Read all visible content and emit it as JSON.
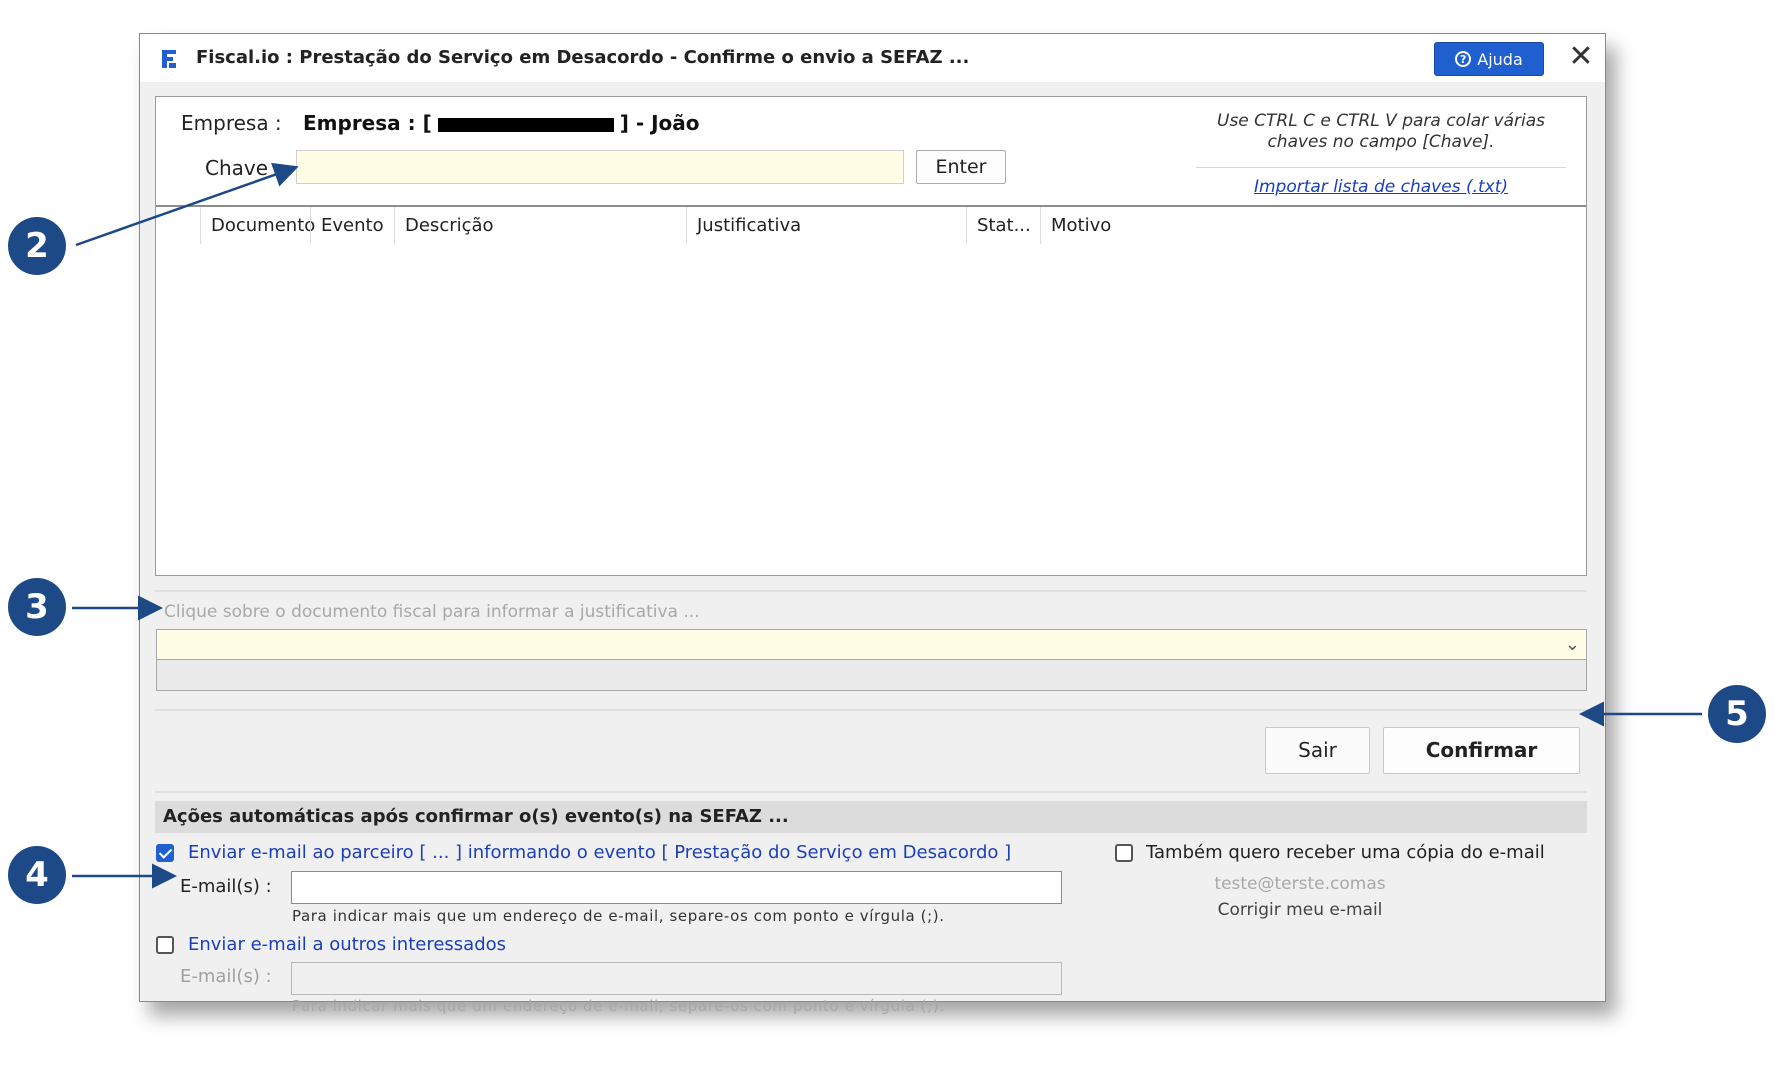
{
  "window": {
    "title": "Fiscal.io : Prestação do Serviço em Desacordo - Confirme o envio a SEFAZ ...",
    "help_label": "Ajuda",
    "close_label": "✕"
  },
  "header": {
    "empresa_label": "Empresa :",
    "empresa_prefix": "Empresa : [",
    "empresa_suffix": "] - João",
    "chave_label": "Chave :",
    "enter_label": "Enter",
    "hint_text": "Use CTRL C e CTRL V para colar várias chaves no campo [Chave].",
    "import_link": "Importar lista de chaves (.txt)"
  },
  "grid": {
    "columns": [
      "Documento",
      "Evento",
      "Descrição",
      "Justificativa",
      "Stat...",
      "Motivo"
    ],
    "rows": []
  },
  "justificativa": {
    "placeholder_label": "Clique sobre o documento fiscal para informar a justificativa ..."
  },
  "actions": {
    "sair_label": "Sair",
    "confirmar_label": "Confirmar"
  },
  "auto": {
    "section_title": "Ações automáticas após confirmar o(s) evento(s) na SEFAZ ...",
    "partner_checkbox_label": "Enviar e-mail ao parceiro [  ... ] informando o evento [ Prestação do Serviço em Desacordo ]",
    "partner_checked": true,
    "emails_label": "E-mail(s) :",
    "emails_hint": "Para indicar mais que um endereço de e-mail, separe-os com ponto e vírgula (;).",
    "others_checkbox_label": "Enviar e-mail a outros interessados",
    "others_checked": false,
    "others_emails_label": "E-mail(s) :",
    "others_emails_hint": "Para indicar mais que um endereço de e-mail, separe-os com ponto e vírgula (;).",
    "copy_checkbox_label": "Também quero receber uma cópia do e-mail",
    "copy_checked": false,
    "my_email": "teste@terste.comas",
    "fix_email_label": "Corrigir meu e-mail"
  },
  "callouts": [
    "2",
    "3",
    "4",
    "5"
  ],
  "colors": {
    "accent": "#1f5fcf",
    "callout": "#1d4a86",
    "input_highlight": "#fffde6",
    "link": "#1a3fb8"
  }
}
